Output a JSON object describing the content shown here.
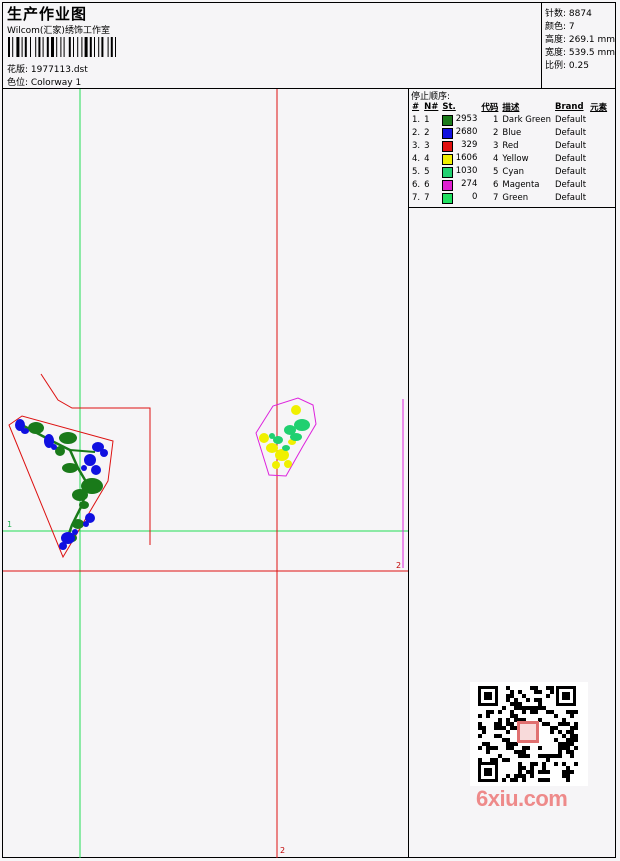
{
  "header": {
    "title": "生产作业图",
    "company": "Wilcom(汇家)绣饰工作室",
    "design_file": "花版: 1977113.dst",
    "colorway": "色位: Colorway 1"
  },
  "stats": [
    "针数: 8874",
    "颜色: 7",
    "高度: 269.1 mm",
    "宽度: 539.5 mm",
    "比例: 0.25"
  ],
  "stop_sequence": {
    "title": "停止顺序:",
    "headers": [
      "#",
      "N#",
      "St.",
      "代码",
      "描述",
      "Brand",
      "元素"
    ],
    "rows": [
      {
        "idx": "1.",
        "n": "1",
        "color": "#1a7a1a",
        "st": "2953",
        "code": "1",
        "desc": "Dark Green",
        "brand": "Default"
      },
      {
        "idx": "2.",
        "n": "2",
        "color": "#1010e0",
        "st": "2680",
        "code": "2",
        "desc": "Blue",
        "brand": "Default"
      },
      {
        "idx": "3.",
        "n": "3",
        "color": "#e01010",
        "st": "329",
        "code": "3",
        "desc": "Red",
        "brand": "Default"
      },
      {
        "idx": "4.",
        "n": "4",
        "color": "#f0f000",
        "st": "1606",
        "code": "4",
        "desc": "Yellow",
        "brand": "Default"
      },
      {
        "idx": "5.",
        "n": "5",
        "color": "#20d070",
        "st": "1030",
        "code": "5",
        "desc": "Cyan",
        "brand": "Default"
      },
      {
        "idx": "6.",
        "n": "6",
        "color": "#e020d0",
        "st": "274",
        "code": "6",
        "desc": "Magenta",
        "brand": "Default"
      },
      {
        "idx": "7.",
        "n": "7",
        "color": "#20e060",
        "st": "0",
        "code": "7",
        "desc": "Green",
        "brand": "Default"
      }
    ]
  },
  "markers": {
    "one": "1",
    "two": "2",
    "bottom": "2"
  },
  "watermark": {
    "text": "6xiu.com"
  }
}
